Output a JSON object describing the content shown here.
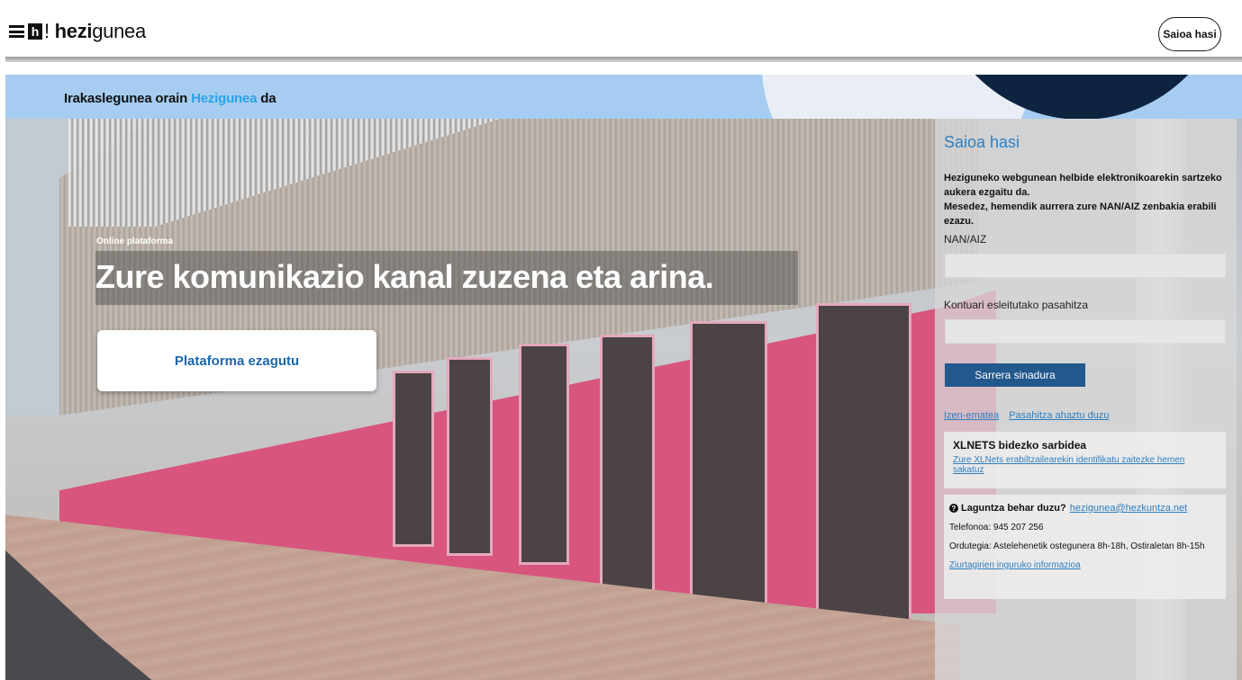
{
  "header": {
    "logo_brand_bold": "hezi",
    "logo_brand_rest": "gunea",
    "logo_mark": "h",
    "logo_exclaim": "!",
    "login_button": "Saioa hasi"
  },
  "banner": {
    "text_before": "Irakaslegunea orain ",
    "text_accent": "Hezigunea",
    "text_after": " da",
    "accent_color": "#2aa3e8"
  },
  "hero": {
    "eyebrow": "Online plataforma",
    "headline": "Zure komunikazio kanal zuzena eta arina.",
    "cta_label": "Plataforma ezagutu"
  },
  "login": {
    "title": "Saioa hasi",
    "message_line1": "Heziguneko webgunean helbide elektronikoarekin sartzeko aukera ezgaitu da.",
    "message_line2": "Mesedez, hemendik aurrera zure NAN/AIZ zenbakia erabili ezazu.",
    "id_label": "NAN/AIZ",
    "id_value": "",
    "password_label": "Kontuari esleitutako pasahitza",
    "password_value": "",
    "submit_label": "Sarrera sinadura",
    "register_link": "Izen-ematea",
    "forgot_link": "Pasahitza ahaztu duzu"
  },
  "xlnets": {
    "title": "XLNETS bidezko sarbidea",
    "link": "Zure XLNets erabiltzailearekin identifikatu zaitezke hemen sakatuz"
  },
  "help": {
    "icon": "question-circle-icon",
    "title": "Laguntza behar duzu?",
    "email": "hezigunea@hezkuntza.net",
    "phone": "Telefonoa: 945 207 256",
    "hours": "Ordutegia: Astelehenetik ostegunera 8h-18h, Ostiraletan 8h-15h",
    "cert_link": "Ziurtagirien inguruko informazioa"
  },
  "colors": {
    "link": "#2d7fc1",
    "button": "#23588c",
    "banner": "#a6cdf1",
    "navy": "#0d2340"
  }
}
